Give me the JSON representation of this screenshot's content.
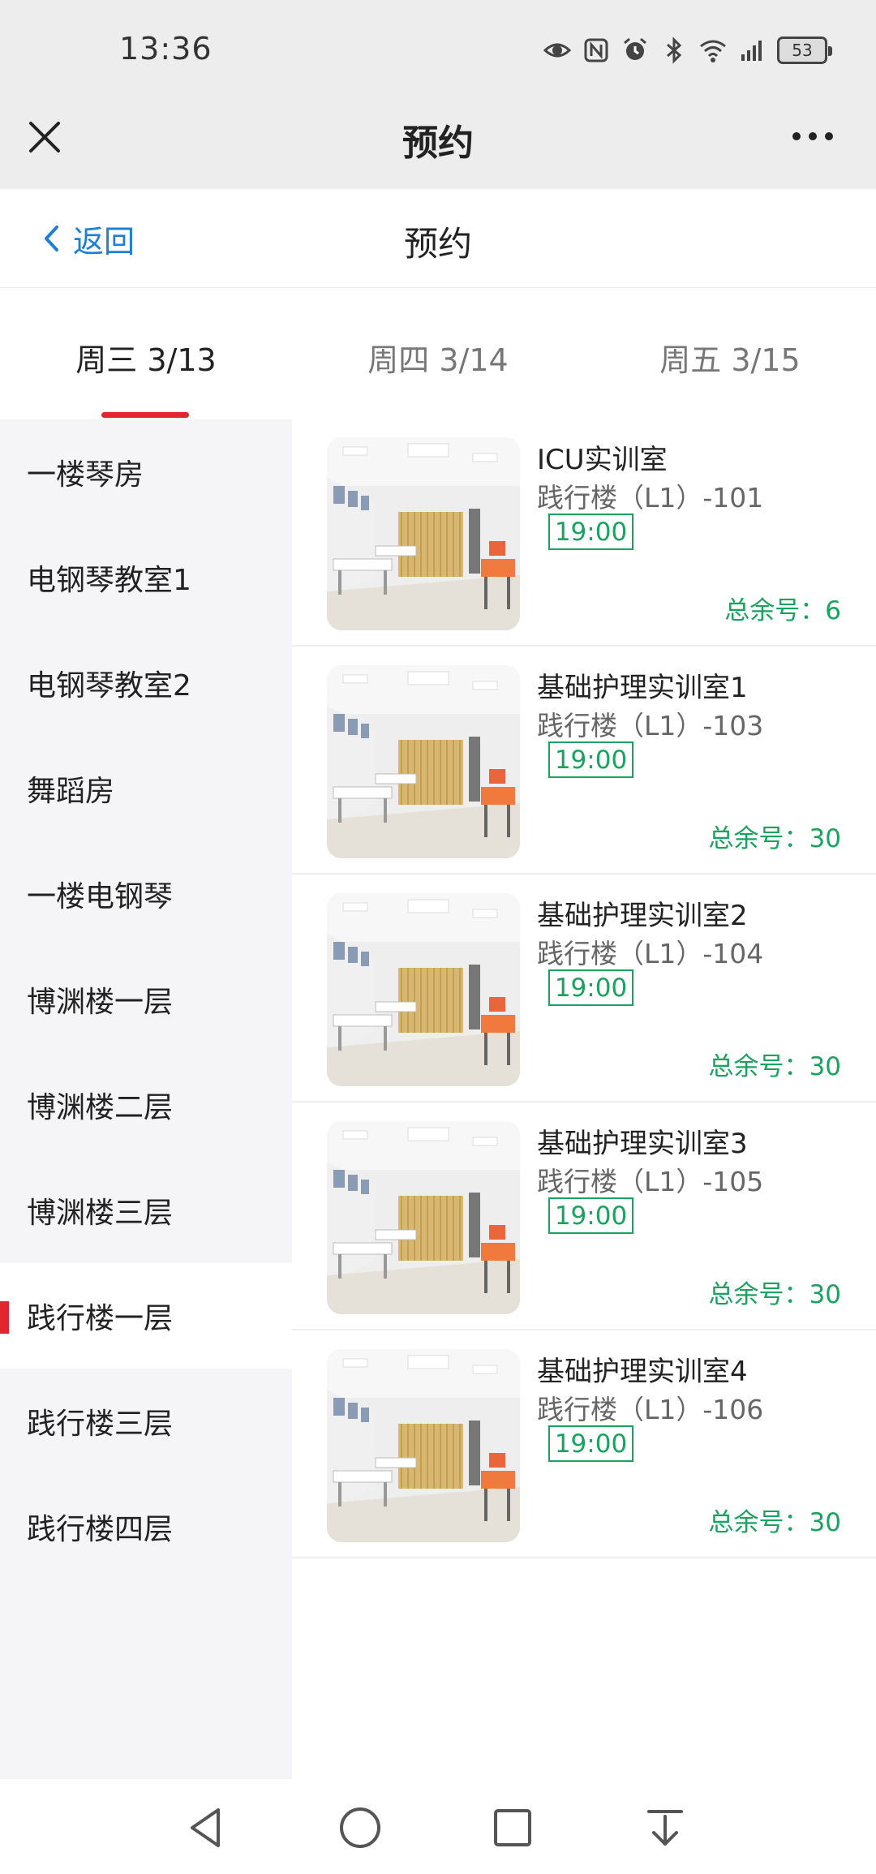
{
  "status_bar": {
    "time": "13:36",
    "battery": "53",
    "icons": [
      "eye-icon",
      "nfc-icon",
      "alarm-icon",
      "bluetooth-icon",
      "wifi-icon",
      "signal-4g-icon",
      "battery-icon"
    ]
  },
  "webview": {
    "title": "预约",
    "close_icon": "close-icon",
    "more_icon": "more-icon"
  },
  "header": {
    "back_label": "返回",
    "title": "预约"
  },
  "tabs": [
    {
      "label": "周三 3/13",
      "active": true
    },
    {
      "label": "周四 3/14",
      "active": false
    },
    {
      "label": "周五 3/15",
      "active": false
    }
  ],
  "sidebar": {
    "items": [
      {
        "label": "一楼琴房",
        "active": false
      },
      {
        "label": "电钢琴教室1",
        "active": false
      },
      {
        "label": "电钢琴教室2",
        "active": false
      },
      {
        "label": "舞蹈房",
        "active": false
      },
      {
        "label": "一楼电钢琴",
        "active": false
      },
      {
        "label": "博渊楼一层",
        "active": false
      },
      {
        "label": "博渊楼二层",
        "active": false
      },
      {
        "label": "博渊楼三层",
        "active": false
      },
      {
        "label": "践行楼一层",
        "active": true
      },
      {
        "label": "践行楼三层",
        "active": false
      },
      {
        "label": "践行楼四层",
        "active": false
      }
    ]
  },
  "rooms": [
    {
      "name": "ICU实训室",
      "location": "践行楼（L1）-101",
      "time": "19:00",
      "remaining": "总余号：6"
    },
    {
      "name": "基础护理实训室1",
      "location": "践行楼（L1）-103",
      "time": "19:00",
      "remaining": "总余号：30"
    },
    {
      "name": "基础护理实训室2",
      "location": "践行楼（L1）-104",
      "time": "19:00",
      "remaining": "总余号：30"
    },
    {
      "name": "基础护理实训室3",
      "location": "践行楼（L1）-105",
      "time": "19:00",
      "remaining": "总余号：30"
    },
    {
      "name": "基础护理实训室4",
      "location": "践行楼（L1）-106",
      "time": "19:00",
      "remaining": "总余号：30"
    }
  ],
  "nav": [
    "back-triangle-icon",
    "home-circle-icon",
    "recents-square-icon",
    "notification-pulldown-icon"
  ],
  "colors": {
    "accent_red": "#e0262e",
    "link_blue": "#1e7fd6",
    "green": "#1aa35f",
    "sidebar_bg": "#f5f5f7",
    "bar_bg": "#ededed"
  }
}
